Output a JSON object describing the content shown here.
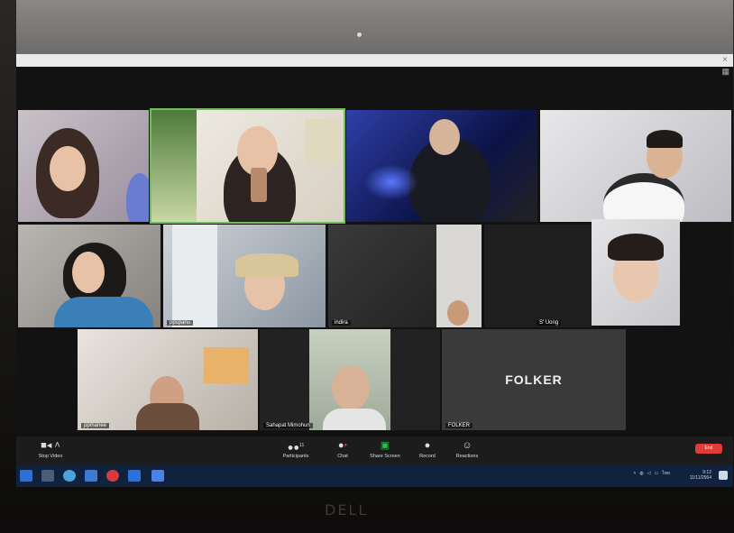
{
  "gallery": {
    "tiles": [
      {
        "id": "r1c1",
        "name": ""
      },
      {
        "id": "r1c2",
        "name": ""
      },
      {
        "id": "r1c3",
        "name": ""
      },
      {
        "id": "r1c4",
        "name": ""
      },
      {
        "id": "r2c1",
        "name": ""
      },
      {
        "id": "r2c2",
        "name": "ppspanu"
      },
      {
        "id": "r2c3",
        "name": "indira"
      },
      {
        "id": "r2c4",
        "name": "S' Uong"
      },
      {
        "id": "r3c1",
        "name": "ppmanee"
      },
      {
        "id": "r3c2",
        "name": "Sahapat Mimohun"
      },
      {
        "id": "r3c3",
        "name": "FOLKER",
        "title": "FOLKER"
      }
    ]
  },
  "toolbar": {
    "stop_video": "Stop Video",
    "participants": "Participants",
    "participants_count": "11",
    "chat": "Chat",
    "share_screen": "Share Screen",
    "record": "Record",
    "reactions": "Reactions",
    "end": "End"
  },
  "taskbar": {
    "clock_time": "9:12",
    "clock_date": "11/11/2564",
    "lang": "ไทย"
  },
  "device": {
    "brand": "DELL"
  },
  "colors": {
    "active_speaker_border": "#6fbf5a",
    "end_button": "#e23b3b",
    "share_screen": "#2fb84f",
    "taskbar": "#10223e"
  }
}
